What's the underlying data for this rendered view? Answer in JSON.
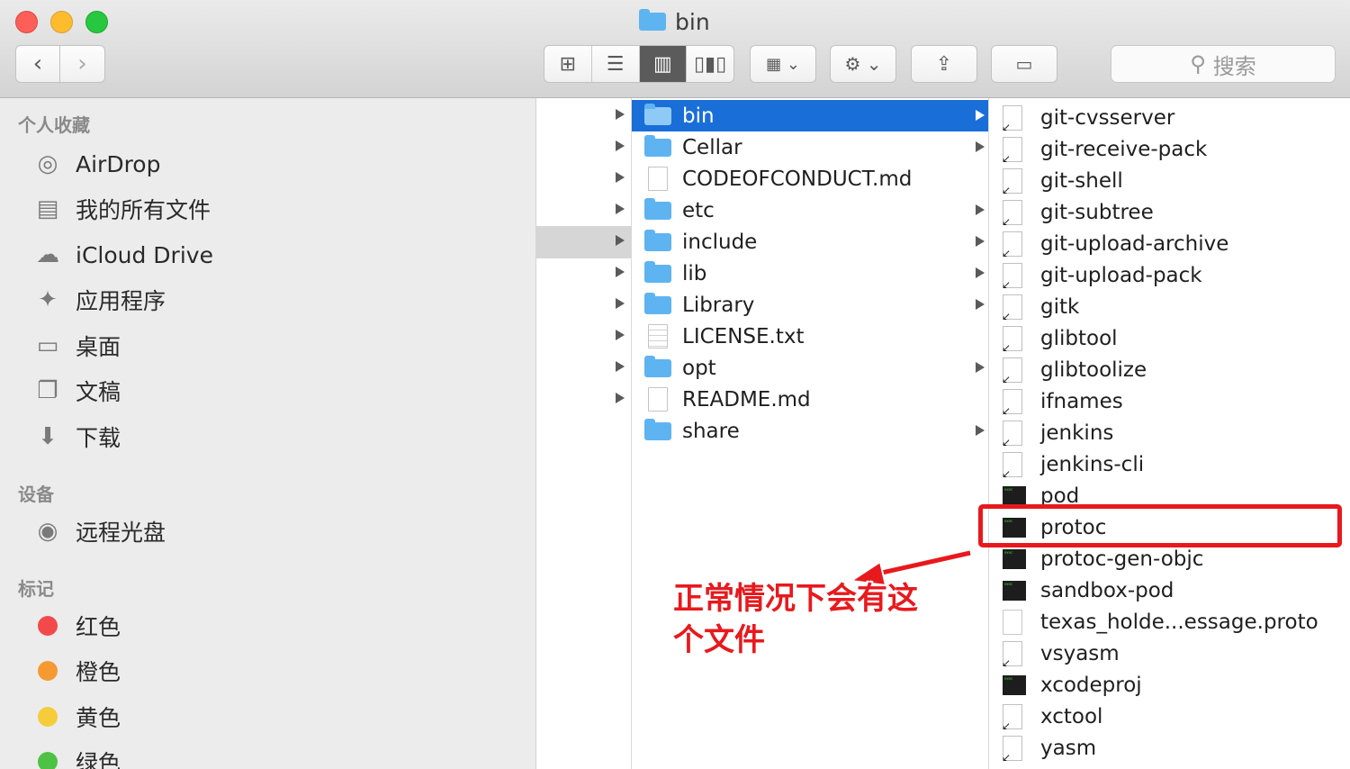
{
  "window": {
    "title": "bin"
  },
  "toolbar": {
    "back_icon": "chevron-left-icon",
    "forward_icon": "chevron-right-icon",
    "view_modes": [
      "icon-view-icon",
      "list-view-icon",
      "column-view-icon",
      "coverflow-view-icon"
    ],
    "active_view": "column-view-icon",
    "search_placeholder": "搜索"
  },
  "sidebar": {
    "favorites_header": "个人收藏",
    "favorites": [
      {
        "label": "AirDrop",
        "icon": "airdrop-icon"
      },
      {
        "label": "我的所有文件",
        "icon": "all-files-icon"
      },
      {
        "label": "iCloud Drive",
        "icon": "cloud-icon"
      },
      {
        "label": "应用程序",
        "icon": "applications-icon"
      },
      {
        "label": "桌面",
        "icon": "desktop-icon"
      },
      {
        "label": "文稿",
        "icon": "documents-icon"
      },
      {
        "label": "下载",
        "icon": "download-icon"
      }
    ],
    "devices_header": "设备",
    "devices": [
      {
        "label": "远程光盘",
        "icon": "disc-icon"
      }
    ],
    "tags_header": "标记",
    "tags": [
      {
        "label": "红色",
        "color": "#f24a4a"
      },
      {
        "label": "橙色",
        "color": "#f59a33"
      },
      {
        "label": "黄色",
        "color": "#f5cc3a"
      },
      {
        "label": "绿色",
        "color": "#4ec244"
      }
    ]
  },
  "column2": {
    "items": [
      {
        "name": "bin",
        "kind": "folder",
        "selected": true
      },
      {
        "name": "Cellar",
        "kind": "folder"
      },
      {
        "name": "CODEOFCONDUCT.md",
        "kind": "doc"
      },
      {
        "name": "etc",
        "kind": "folder"
      },
      {
        "name": "include",
        "kind": "folder"
      },
      {
        "name": "lib",
        "kind": "folder"
      },
      {
        "name": "Library",
        "kind": "folder"
      },
      {
        "name": "LICENSE.txt",
        "kind": "textdoc"
      },
      {
        "name": "opt",
        "kind": "folder"
      },
      {
        "name": "README.md",
        "kind": "doc"
      },
      {
        "name": "share",
        "kind": "folder"
      }
    ]
  },
  "column3": {
    "items": [
      {
        "name": "git-cvsserver",
        "kind": "alias"
      },
      {
        "name": "git-receive-pack",
        "kind": "alias"
      },
      {
        "name": "git-shell",
        "kind": "alias"
      },
      {
        "name": "git-subtree",
        "kind": "alias"
      },
      {
        "name": "git-upload-archive",
        "kind": "alias"
      },
      {
        "name": "git-upload-pack",
        "kind": "alias"
      },
      {
        "name": "gitk",
        "kind": "alias"
      },
      {
        "name": "glibtool",
        "kind": "alias"
      },
      {
        "name": "glibtoolize",
        "kind": "alias"
      },
      {
        "name": "ifnames",
        "kind": "alias"
      },
      {
        "name": "jenkins",
        "kind": "alias"
      },
      {
        "name": "jenkins-cli",
        "kind": "alias"
      },
      {
        "name": "pod",
        "kind": "exec"
      },
      {
        "name": "protoc",
        "kind": "exec"
      },
      {
        "name": "protoc-gen-objc",
        "kind": "exec"
      },
      {
        "name": "sandbox-pod",
        "kind": "exec"
      },
      {
        "name": "texas_holde...essage.proto",
        "kind": "plain"
      },
      {
        "name": "vsyasm",
        "kind": "alias"
      },
      {
        "name": "xcodeproj",
        "kind": "exec"
      },
      {
        "name": "xctool",
        "kind": "alias"
      },
      {
        "name": "yasm",
        "kind": "alias"
      }
    ]
  },
  "annotation": {
    "text": "正常情况下会有这个文件",
    "line1": "正常情况下会有这",
    "line2": "个文件",
    "color": "#e8191d"
  }
}
